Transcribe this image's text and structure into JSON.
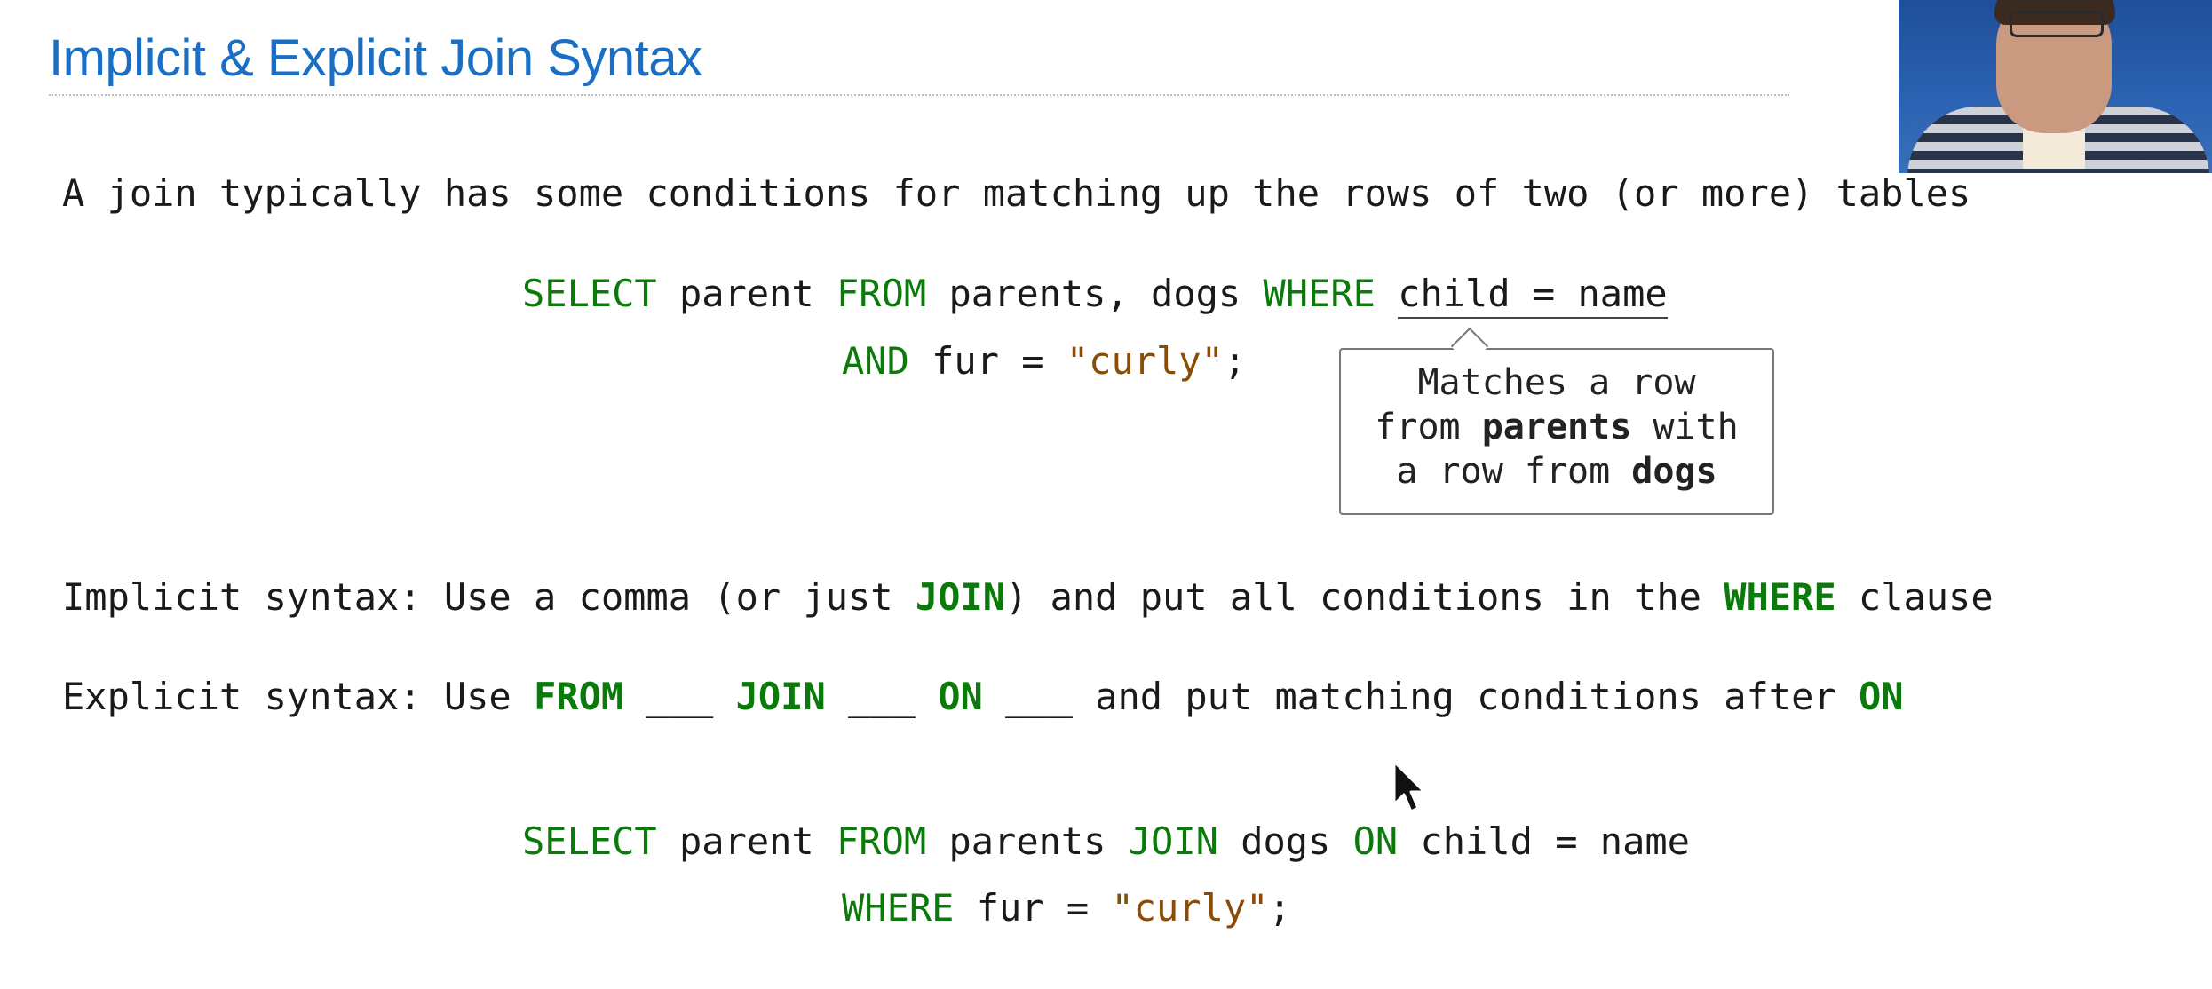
{
  "slide": {
    "title": "Implicit & Explicit Join Syntax",
    "intro": "A join typically has some conditions for matching up the rows of two (or more) tables"
  },
  "query1": {
    "line1": {
      "kw1": "SELECT",
      "t1": " parent ",
      "kw2": "FROM",
      "t2": " parents, dogs ",
      "kw3": "WHERE",
      "t3": " ",
      "underlined": "child = name"
    },
    "line2": {
      "kw1": "AND",
      "t1": " fur = ",
      "str": "\"curly\"",
      "t2": ";"
    }
  },
  "callout": {
    "l1": "Matches a row",
    "l2a": "from ",
    "l2b": "parents",
    "l2c": " with",
    "l3a": "a row from ",
    "l3b": "dogs"
  },
  "implicit": {
    "a": "Implicit syntax: Use a comma (or just ",
    "kw1": "JOIN",
    "b": ") and put all conditions in the ",
    "kw2": "WHERE",
    "c": " clause"
  },
  "explicit": {
    "a": "Explicit syntax: Use ",
    "kw1": "FROM",
    "b": " ___ ",
    "kw2": "JOIN",
    "c": " ___ ",
    "kw3": "ON",
    "d": " ___ and put matching conditions after ",
    "kw4": "ON"
  },
  "query2": {
    "line1": {
      "kw1": "SELECT",
      "t1": " parent ",
      "kw2": "FROM",
      "t2": " parents ",
      "kw3": "JOIN",
      "t3": " dogs ",
      "kw4": "ON",
      "t4": " child = name"
    },
    "line2": {
      "kw1": "WHERE",
      "t1": " fur = ",
      "str": "\"curly\"",
      "t2": ";"
    }
  },
  "colors": {
    "title": "#1a6fc4",
    "keyword": "#0a7a0a",
    "string": "#8a4b07",
    "text": "#1a1a1a"
  },
  "icons": {
    "cursor": "mouse-pointer-icon"
  }
}
